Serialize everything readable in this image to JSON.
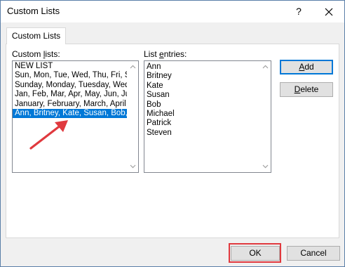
{
  "window": {
    "title": "Custom Lists",
    "help_glyph": "?"
  },
  "tab": {
    "label": "Custom Lists"
  },
  "custom_lists": {
    "label_prefix": "Custom ",
    "label_accel": "l",
    "label_suffix": "ists:",
    "items": [
      "NEW LIST",
      "Sun, Mon, Tue, Wed, Thu, Fri, S",
      "Sunday, Monday, Tuesday, Wed",
      "Jan, Feb, Mar, Apr, May, Jun, Ju",
      "January, February, March, April",
      "Ann, Britney, Kate, Susan, Bob, M"
    ],
    "selected_index": 5
  },
  "list_entries": {
    "label_prefix": "List ",
    "label_accel": "e",
    "label_suffix": "ntries:",
    "items": [
      "Ann",
      "Britney",
      "Kate",
      "Susan",
      "Bob",
      "Michael",
      "Patrick",
      "Steven"
    ]
  },
  "buttons": {
    "add_accel": "A",
    "add_rest": "dd",
    "delete_accel": "D",
    "delete_rest": "elete",
    "ok": "OK",
    "cancel": "Cancel"
  },
  "annotations": {
    "arrow_color": "#e0393e",
    "highlight_color": "#e0393e"
  },
  "colors": {
    "selection": "#0078d7",
    "default_button_border": "#0078d7"
  }
}
